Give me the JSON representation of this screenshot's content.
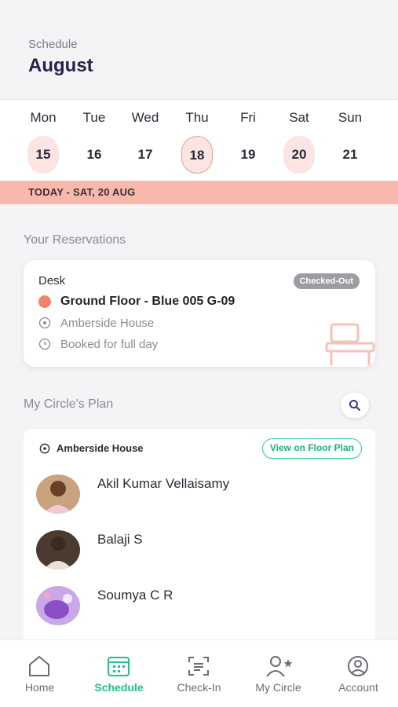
{
  "header": {
    "subtitle": "Schedule",
    "month": "August"
  },
  "week": [
    {
      "name": "Mon",
      "date": "15",
      "style": "tint"
    },
    {
      "name": "Tue",
      "date": "16",
      "style": ""
    },
    {
      "name": "Wed",
      "date": "17",
      "style": ""
    },
    {
      "name": "Thu",
      "date": "18",
      "style": "ring"
    },
    {
      "name": "Fri",
      "date": "19",
      "style": ""
    },
    {
      "name": "Sat",
      "date": "20",
      "style": "tint"
    },
    {
      "name": "Sun",
      "date": "21",
      "style": ""
    }
  ],
  "today_banner": "TODAY - SAT, 20 AUG",
  "reservations": {
    "title": "Your Reservations",
    "card": {
      "type": "Desk",
      "status": "Checked-Out",
      "floor": "Ground Floor - Blue 005 G-09",
      "location": "Amberside House",
      "duration": "Booked for full day"
    }
  },
  "circle": {
    "title": "My Circle's Plan",
    "location": "Amberside House",
    "floor_plan_button": "View on Floor Plan",
    "people": [
      {
        "name": "Akil Kumar Vellaisamy"
      },
      {
        "name": "Balaji S"
      },
      {
        "name": "Soumya C R"
      }
    ]
  },
  "tabs": [
    {
      "label": "Home",
      "icon": "home-icon"
    },
    {
      "label": "Schedule",
      "icon": "calendar-icon",
      "active": true
    },
    {
      "label": "Check-In",
      "icon": "scan-icon"
    },
    {
      "label": "My Circle",
      "icon": "user-star-icon"
    },
    {
      "label": "Account",
      "icon": "account-icon"
    }
  ],
  "colors": {
    "accent": "#1fc08d",
    "banner": "#f8b9ac",
    "date_tint": "#fbe4e1",
    "reservation_dot": "#f2836b"
  }
}
